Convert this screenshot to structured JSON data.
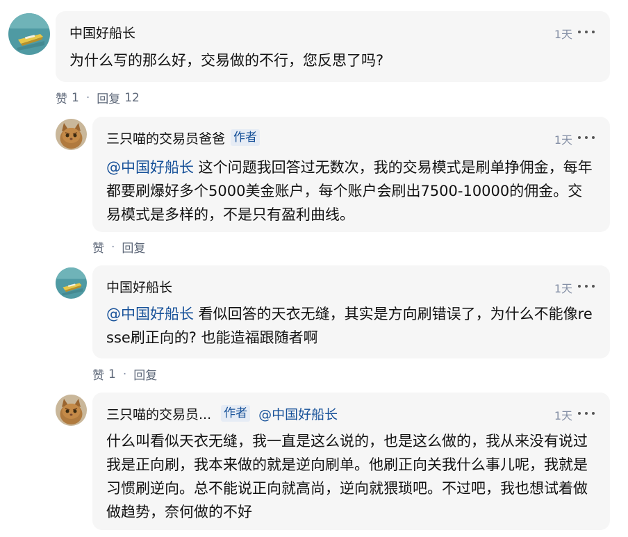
{
  "comments": [
    {
      "user": "中国好船长",
      "time": "1天",
      "text": "为什么写的那么好，交易做的不行，您反思了吗?",
      "actions": {
        "like": "赞",
        "like_count": "1",
        "reply": "回复",
        "reply_count": "12"
      }
    },
    {
      "user": "三只喵的交易员爸爸",
      "author_tag": "作者",
      "time": "1天",
      "mention": "@中国好船长",
      "text": " 这个问题我回答过无数次，我的交易模式是刷单挣佣金，每年都要刷爆好多个5000美金账户，每个账户会刷出7500-10000的佣金。交易模式是多样的，不是只有盈利曲线。",
      "actions": {
        "like": "赞",
        "reply": "回复"
      }
    },
    {
      "user": "中国好船长",
      "time": "1天",
      "mention": "@中国好船长",
      "text": " 看似回答的天衣无缝，其实是方向刷错误了，为什么不能像resse刷正向的? 也能造福跟随者啊",
      "actions": {
        "like": "赞",
        "like_count": "1",
        "reply": "回复"
      }
    },
    {
      "user": "三只喵的交易员...",
      "author_tag": "作者",
      "reply_to": "@中国好船长",
      "time": "1天",
      "text": "什么叫看似天衣无缝，我一直是这么说的，也是这么做的，我从来没有说过我是正向刷，我本来做的就是逆向刷单。他刷正向关我什么事儿呢，我就是习惯刷逆向。总不能说正向就高尚，逆向就猥琐吧。不过吧，我也想试着做做趋势，奈何做的不好"
    }
  ],
  "icons": {
    "boat_avatar": "boat-avatar-icon",
    "cat_avatar": "cat-avatar-icon",
    "more": "more-options-icon"
  },
  "colors": {
    "link": "#175199",
    "bubble": "#f6f6f6",
    "meta": "#8590a6"
  }
}
